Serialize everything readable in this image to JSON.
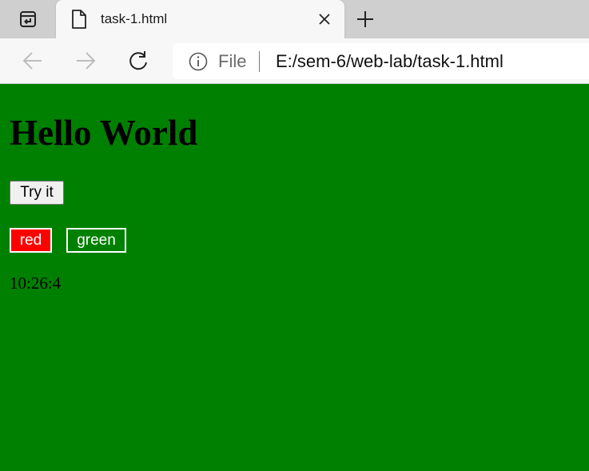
{
  "browser": {
    "tab": {
      "title": "task-1.html",
      "close_icon": "close-icon",
      "file_icon": "file-icon"
    },
    "new_tab_icon": "plus-icon",
    "tab_actions_icon": "tab-actions-icon",
    "toolbar": {
      "back_icon": "arrow-left-icon",
      "forward_icon": "arrow-right-icon",
      "reload_icon": "reload-icon",
      "info_icon": "info-icon",
      "scheme_label": "File",
      "url": "E:/sem-6/web-lab/task-1.html"
    }
  },
  "page": {
    "heading": "Hello World",
    "try_button_label": "Try it",
    "red_button_label": "red",
    "green_button_label": "green",
    "clock_text": "10:26:4"
  },
  "colors": {
    "page_background": "#008000",
    "red_button": "#ff0000",
    "green_button": "#008000",
    "button_border": "#ffffff"
  }
}
